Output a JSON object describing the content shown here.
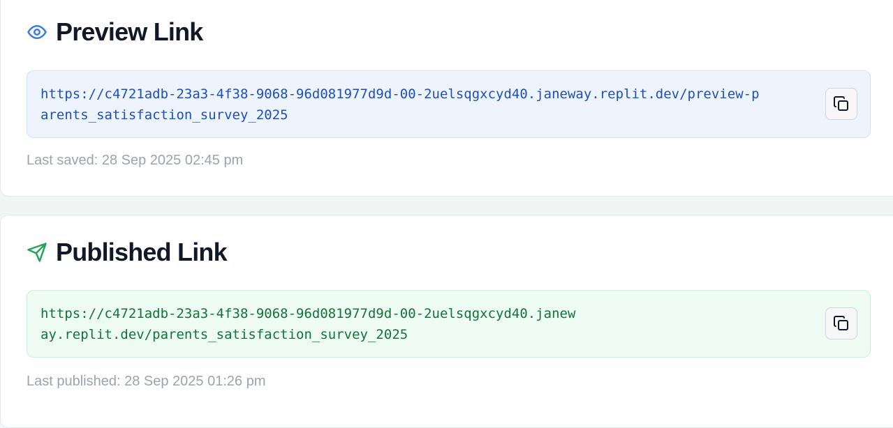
{
  "preview": {
    "icon": "eye-icon",
    "title": "Preview Link",
    "url": "https://c4721adb-23a3-4f38-9068-96d081977d9d-00-2uelsqgxcyd40.janeway.replit.dev/preview-parents_satisfaction_survey_2025",
    "copy_icon": "copy-icon",
    "meta": "Last saved: 28 Sep 2025 02:45 pm",
    "accent": "#3b7ddd"
  },
  "published": {
    "icon": "send-icon",
    "title": "Published Link",
    "url": "https://c4721adb-23a3-4f38-9068-96d081977d9d-00-2uelsqgxcyd40.janeway.replit.dev/parents_satisfaction_survey_2025",
    "copy_icon": "copy-icon",
    "meta": "Last published: 28 Sep 2025 01:26 pm",
    "accent": "#22a55a"
  }
}
